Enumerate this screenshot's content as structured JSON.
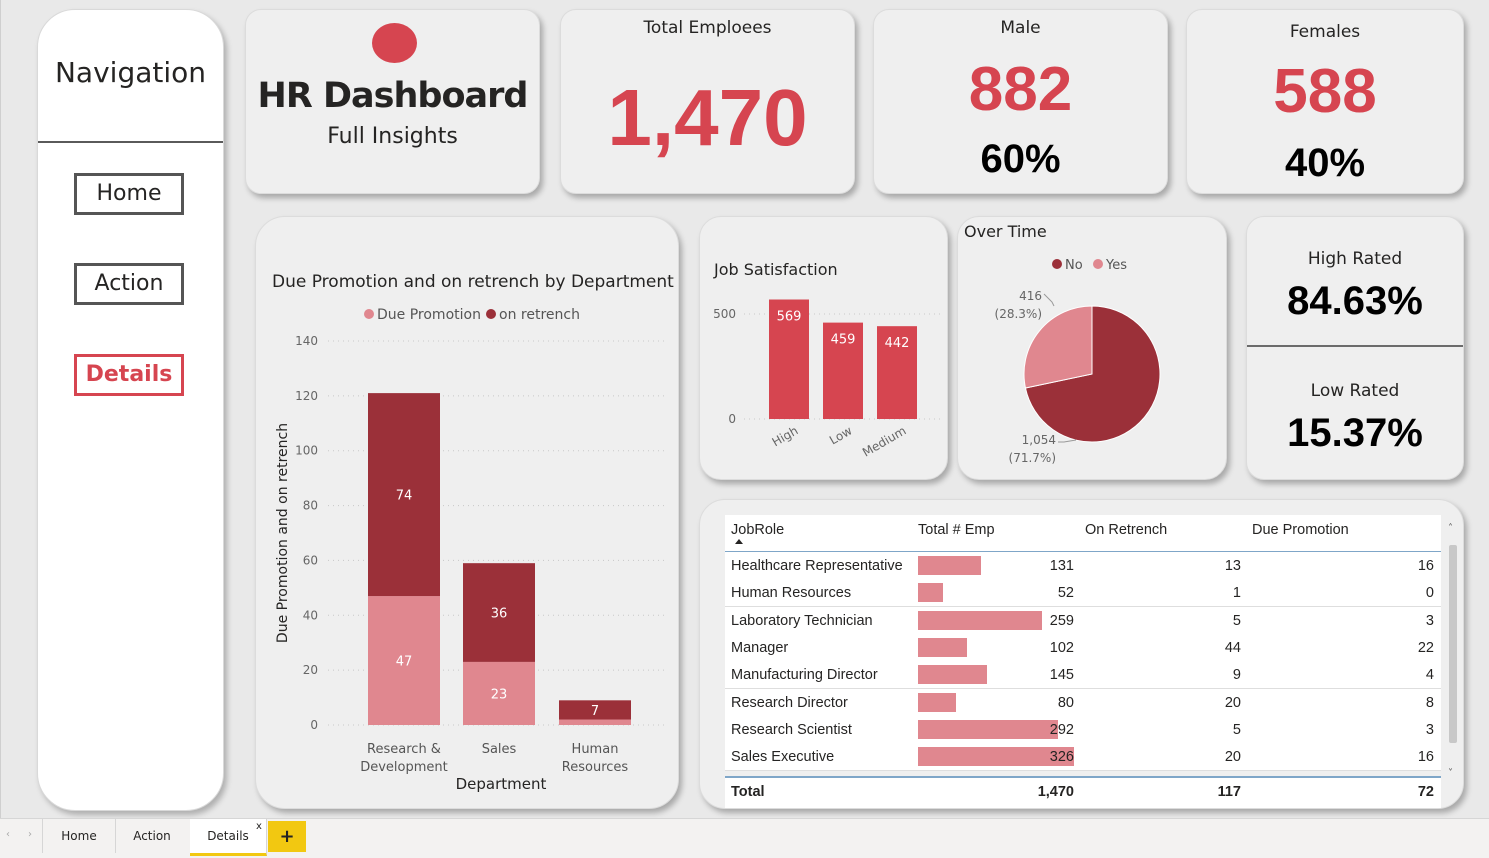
{
  "navigation": {
    "title": "Navigation",
    "buttons": [
      "Home",
      "Action",
      "Details"
    ],
    "active": "Details"
  },
  "header": {
    "title": "HR Dashboard",
    "subtitle": "Full Insights"
  },
  "kpis": {
    "total": {
      "label": "Total Emploees",
      "value": "1,470"
    },
    "male": {
      "label": "Male",
      "value": "882",
      "pct": "60%"
    },
    "female": {
      "label": "Females",
      "value": "588",
      "pct": "40%"
    },
    "high_rated": {
      "label": "High Rated",
      "value": "84.63%"
    },
    "low_rated": {
      "label": "Low Rated",
      "value": "15.37%"
    }
  },
  "colors": {
    "accent": "#d64550",
    "dark": "#9b3039",
    "light": "#e0878f"
  },
  "chart_data": [
    {
      "type": "bar",
      "stacked": true,
      "title": "Due Promotion and on retrench by Department",
      "xlabel": "Department",
      "ylabel": "Due Promotion and on retrench",
      "ylim": [
        0,
        140
      ],
      "yticks": [
        0,
        20,
        40,
        60,
        80,
        100,
        120,
        140
      ],
      "categories": [
        "Research & Development",
        "Sales",
        "Human Resources"
      ],
      "category_lines": [
        [
          "Research &",
          "Development"
        ],
        [
          "Sales"
        ],
        [
          "Human",
          "Resources"
        ]
      ],
      "series": [
        {
          "name": "Due Promotion",
          "values": [
            47,
            23,
            2
          ],
          "labels": [
            "47",
            "23",
            ""
          ]
        },
        {
          "name": "on retrench",
          "values": [
            74,
            36,
            7
          ],
          "labels": [
            "74",
            "36",
            "7"
          ]
        }
      ],
      "legend": "top-center",
      "grid": true
    },
    {
      "type": "bar",
      "title": "Job Satisfaction",
      "categories": [
        "High",
        "Low",
        "Medium"
      ],
      "values": [
        569,
        459,
        442
      ],
      "yticks": [
        0,
        500
      ],
      "ylim": [
        0,
        600
      ],
      "grid": true
    },
    {
      "type": "pie",
      "title": "Over Time",
      "categories": [
        "No",
        "Yes"
      ],
      "values": [
        1054,
        416
      ],
      "labels": [
        [
          "1,054",
          "(71.7%)"
        ],
        [
          "416",
          "(28.3%)"
        ]
      ],
      "legend": "top-center"
    }
  ],
  "table": {
    "columns": [
      "JobRole",
      "Total # Emp",
      "On Retrench",
      "Due Promotion"
    ],
    "rows": [
      {
        "role": "Healthcare Representative",
        "total": 131,
        "total_s": "131",
        "retrench": "13",
        "promo": "16"
      },
      {
        "role": "Human Resources",
        "total": 52,
        "total_s": "52",
        "retrench": "1",
        "promo": "0"
      },
      {
        "role": "Laboratory Technician",
        "total": 259,
        "total_s": "259",
        "retrench": "5",
        "promo": "3"
      },
      {
        "role": "Manager",
        "total": 102,
        "total_s": "102",
        "retrench": "44",
        "promo": "22"
      },
      {
        "role": "Manufacturing Director",
        "total": 145,
        "total_s": "145",
        "retrench": "9",
        "promo": "4"
      },
      {
        "role": "Research Director",
        "total": 80,
        "total_s": "80",
        "retrench": "20",
        "promo": "8"
      },
      {
        "role": "Research Scientist",
        "total": 292,
        "total_s": "292",
        "retrench": "5",
        "promo": "3"
      },
      {
        "role": "Sales Executive",
        "total": 326,
        "total_s": "326",
        "retrench": "20",
        "promo": "16"
      }
    ],
    "totals": {
      "label": "Total",
      "total": "1,470",
      "retrench": "117",
      "promo": "72"
    }
  },
  "tabs": [
    "Home",
    "Action",
    "Details"
  ],
  "active_tab": "Details",
  "tab_close": "x",
  "tab_add": "+"
}
